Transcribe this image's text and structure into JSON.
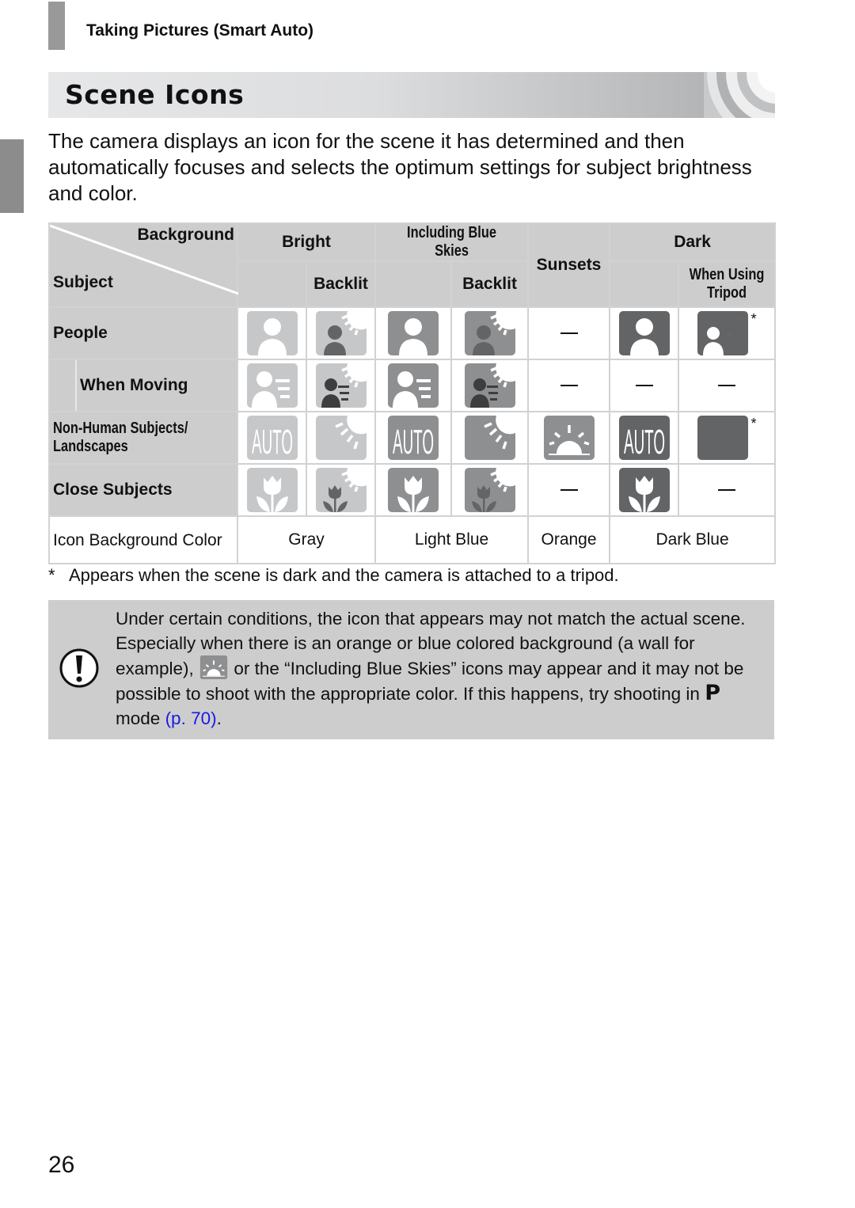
{
  "header": {
    "section": "Taking Pictures (Smart Auto)"
  },
  "title": "Scene Icons",
  "intro": "The camera displays an icon for the scene it has determined and then automatically focuses and selects the optimum settings for subject brightness and color.",
  "table": {
    "corner_background": "Background",
    "corner_subject": "Subject",
    "columns": {
      "bright": "Bright",
      "bright_backlit": "Backlit",
      "blue_skies": "Including Blue Skies",
      "blue_skies_backlit": "Backlit",
      "sunsets": "Sunsets",
      "dark": "Dark",
      "dark_tripod": "When Using Tripod"
    },
    "rows": {
      "people": "People",
      "when_moving": "When Moving",
      "non_human": "Non-Human Subjects/ Landscapes",
      "close": "Close Subjects",
      "icon_bg": "Icon Background Color"
    },
    "cells": {
      "people": [
        "person-icon",
        "person-backlit-icon",
        "person-icon",
        "person-backlit-icon",
        "none",
        "person-icon",
        "person-night-icon*"
      ],
      "when_moving": [
        "person-moving-icon",
        "person-moving-backlit-icon",
        "person-moving-icon",
        "person-moving-backlit-icon",
        "none",
        "none",
        "none"
      ],
      "non_human": [
        "auto-icon",
        "backlit-icon",
        "auto-icon",
        "backlit-icon",
        "sunset-icon",
        "auto-icon",
        "night-moon-icon*"
      ],
      "close": [
        "macro-icon",
        "macro-backlit-icon",
        "macro-icon",
        "macro-backlit-icon",
        "none",
        "macro-icon",
        "none"
      ]
    },
    "bg_colors": {
      "gray": "Gray",
      "light_blue": "Light Blue",
      "orange": "Orange",
      "dark_blue": "Dark Blue"
    },
    "dash": "—",
    "asterisk": "*"
  },
  "icon_colors": {
    "gray": "#c6c7c9",
    "light_blue": "#8e8f91",
    "orange": "#8e8f91",
    "dark_blue": "#636466"
  },
  "footnote": {
    "mark": "*",
    "text": "Appears when the scene is dark and the camera is attached to a tripod."
  },
  "caution": {
    "line1": "Under certain conditions, the icon that appears may not match the actual scene. Especially when there is an orange or blue colored background (a wall for example),",
    "line2": "or the “Including Blue Skies” icons may appear and it may not be possible to shoot with the appropriate color. If this happens, try shooting in",
    "mode": "P",
    "line3": "mode",
    "link": "(p. 70)",
    "end": "."
  },
  "page_number": "26"
}
